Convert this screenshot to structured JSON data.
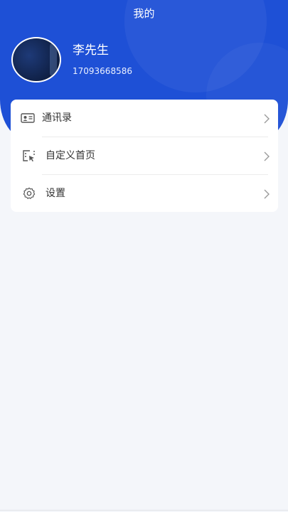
{
  "header": {
    "title": "我的",
    "background_color": "#1e50d6"
  },
  "profile": {
    "name": "李先生",
    "phone": "17093668586"
  },
  "menu": {
    "items": [
      {
        "label": "通讯录",
        "icon": "contact-card-icon"
      },
      {
        "label": "自定义首页",
        "icon": "custom-home-icon"
      },
      {
        "label": "设置",
        "icon": "gear-icon"
      }
    ]
  }
}
